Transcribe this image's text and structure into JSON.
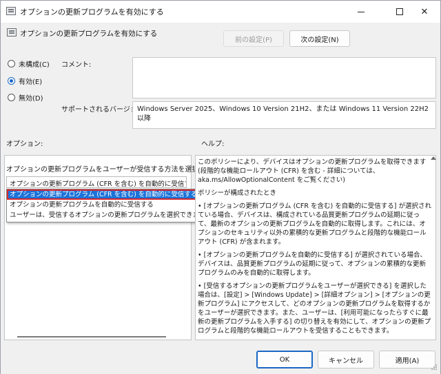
{
  "window": {
    "title": "オプションの更新プログラムを有効にする",
    "minimize_icon": "minimize-icon",
    "maximize_icon": "maximize-icon",
    "close_icon": "close-icon",
    "close_glyph": "✕"
  },
  "header": {
    "policy_title": "オプションの更新プログラムを有効にする",
    "prev_button": "前の設定(P)",
    "next_button": "次の設定(N)"
  },
  "state": {
    "options": [
      {
        "label": "未構成(C)",
        "checked": false
      },
      {
        "label": "有効(E)",
        "checked": true
      },
      {
        "label": "無効(D)",
        "checked": false
      }
    ]
  },
  "comment": {
    "label": "コメント:",
    "value": ""
  },
  "supported": {
    "label": "サポートされるバージョン:",
    "value": "Windows Server 2025、Windows 10 Version 21H2、または Windows 11 Version 22H2 以降"
  },
  "options_panel": {
    "title": "オプション:",
    "select_label": "オプションの更新プログラムをユーザーが受信する方法を選択する:",
    "selected_value": "オプションの更新プログラム (CFR を含む) を自動的に受信する",
    "dropdown_items": [
      "オプションの更新プログラム (CFR を含む) を自動的に受信する",
      "オプションの更新プログラムを自動的に受信する",
      "ユーザーは、受信するオプションの更新プログラムを選択できます"
    ]
  },
  "help_panel": {
    "title": "ヘルプ:",
    "paragraphs": [
      "このポリシーにより、デバイスはオプションの更新プログラムを取得できます (段階的な機能ロールアウト (CFR) を含む - 詳細については、aka.ms/AllowOptionalContent をご覧ください)",
      "ポリシーが構成されたとき",
      "• [オプションの更新プログラム (CFR を含む) を自動的に受信する] が選択されている場合、デバイスは、構成されている品質更新プログラムの延期に従って、最新のオプションの更新プログラムを自動的に取得します。これには、オプションのセキュリティ以外の累積的な更新プログラムと段階的な機能ロールアウト (CFR) が含まれます。",
      "• [オプションの更新プログラムを自動的に受信する] が選択されている場合、デバイスは、品質更新プログラムの延期に従って、オプションの累積的な更新プログラムのみを自動的に取得します。",
      "• [受信するオプションの更新プログラムをユーザーが選択できる] を選択した場合は、[設定] > [Windows Update] > [詳細オプション] > [オプションの更新プログラム] にアクセスして、どのオプションの更新プログラムを取得するかをユーザーが選択できます。また、ユーザーは、[利用可能になったらすぐに最新の更新プログラムを入手する] の切り替えを有効にして、オプションの更新プログラムと段階的な機能ロールアウトを受信することもできます。"
    ]
  },
  "footer": {
    "ok": "OK",
    "cancel": "キャンセル",
    "apply": "適用(A)"
  },
  "colors": {
    "accent": "#1a66c4",
    "selection": "#1a73d9",
    "highlight_border": "#d4282f"
  }
}
